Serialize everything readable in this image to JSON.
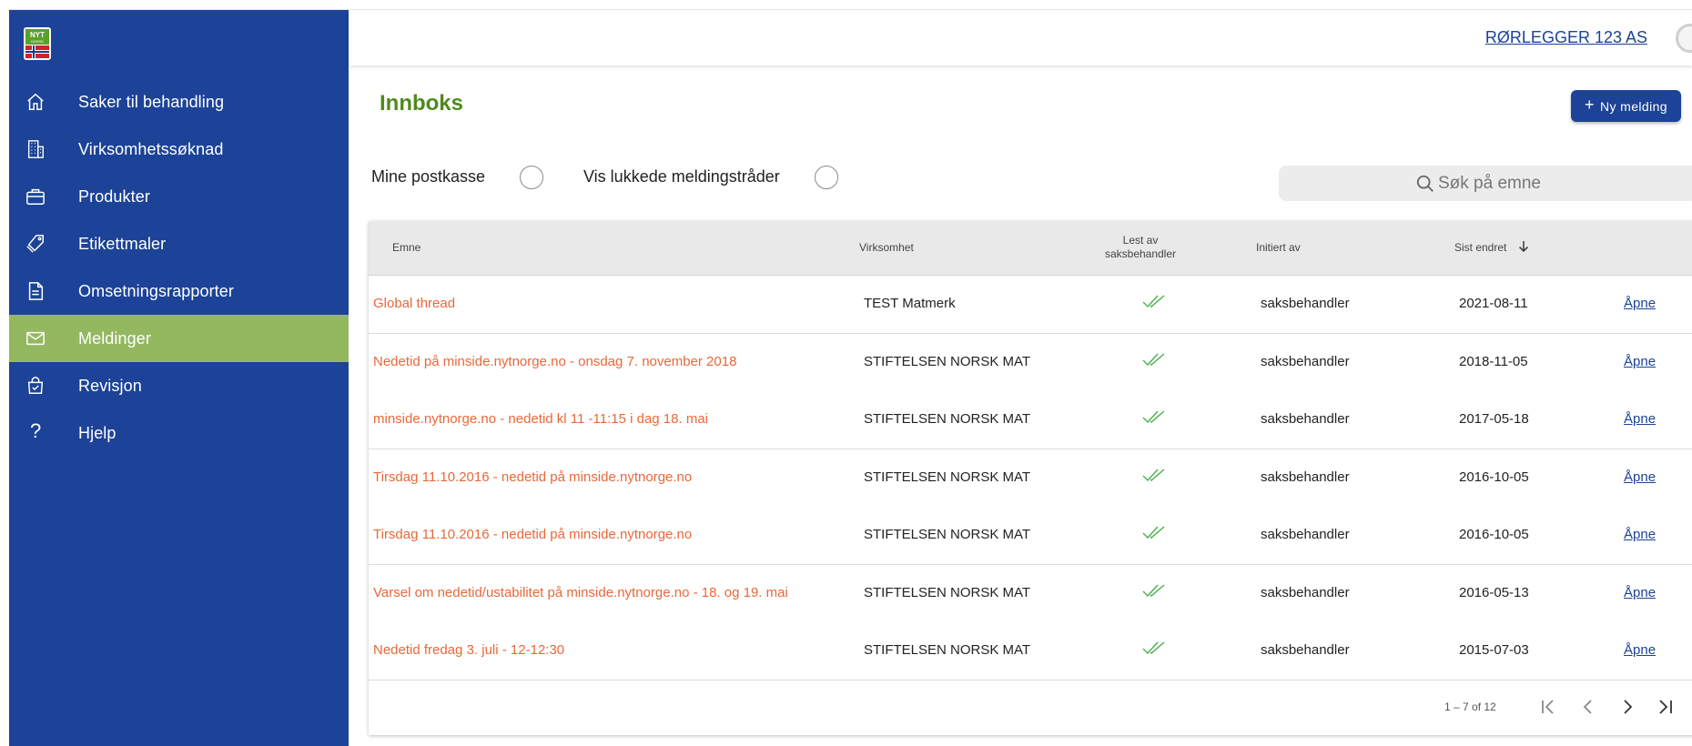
{
  "brand": {
    "logo_text_top": "NYT",
    "logo_text_mid": "NORSK"
  },
  "sidebar": {
    "items": [
      {
        "label": "Saker til behandling",
        "icon": "home-icon"
      },
      {
        "label": "Virksomhetssøknad",
        "icon": "building-icon"
      },
      {
        "label": "Produkter",
        "icon": "briefcase-icon"
      },
      {
        "label": "Etikettmaler",
        "icon": "tags-icon"
      },
      {
        "label": "Omsetningsrapporter",
        "icon": "document-icon"
      },
      {
        "label": "Meldinger",
        "icon": "mail-icon",
        "active": true
      },
      {
        "label": "Revisjon",
        "icon": "shopping-bag-check-icon"
      },
      {
        "label": "Hjelp",
        "icon": "question-icon"
      }
    ]
  },
  "header": {
    "company": "RØRLEGGER 123 AS"
  },
  "page": {
    "title": "Innboks",
    "new_button": "Ny melding"
  },
  "filters": {
    "my_mailbox": "Mine postkasse",
    "show_closed": "Vis lukkede meldingstråder"
  },
  "search": {
    "placeholder": "Søk på emne"
  },
  "table": {
    "headers": {
      "subject": "Emne",
      "company": "Virksomhet",
      "read_line1": "Lest av",
      "read_line2": "saksbehandler",
      "initiated": "Initiert av",
      "last_changed": "Sist endret"
    },
    "rows": [
      {
        "subject": "Global thread",
        "company": "TEST Matmerk",
        "initiated": "saksbehandler",
        "date": "2021-08-11",
        "action": "Åpne"
      },
      {
        "subject": "Nedetid på minside.nytnorge.no - onsdag 7. november 2018",
        "company": "STIFTELSEN NORSK MAT",
        "initiated": "saksbehandler",
        "date": "2018-11-05",
        "action": "Åpne"
      },
      {
        "subject": "minside.nytnorge.no - nedetid kl 11 -11:15 i dag 18. mai",
        "company": "STIFTELSEN NORSK MAT",
        "initiated": "saksbehandler",
        "date": "2017-05-18",
        "action": "Åpne"
      },
      {
        "subject": "Tirsdag 11.10.2016 - nedetid på minside.nytnorge.no",
        "company": "STIFTELSEN NORSK MAT",
        "initiated": "saksbehandler",
        "date": "2016-10-05",
        "action": "Åpne"
      },
      {
        "subject": "Tirsdag 11.10.2016 - nedetid på minside.nytnorge.no",
        "company": "STIFTELSEN NORSK MAT",
        "initiated": "saksbehandler",
        "date": "2016-10-05",
        "action": "Åpne"
      },
      {
        "subject": "Varsel om nedetid/ustabilitet på minside.nytnorge.no - 18. og 19. mai",
        "company": "STIFTELSEN NORSK MAT",
        "initiated": "saksbehandler",
        "date": "2016-05-13",
        "action": "Åpne"
      },
      {
        "subject": "Nedetid fredag 3. juli - 12-12:30",
        "company": "STIFTELSEN NORSK MAT",
        "initiated": "saksbehandler",
        "date": "2015-07-03",
        "action": "Åpne"
      }
    ]
  },
  "pagination": {
    "range": "1 – 7 of 12"
  },
  "colors": {
    "sidebar": "#1c4397",
    "active": "#93b860",
    "title": "#4e8a1e",
    "subject": "#e8683a",
    "check": "#4caf50"
  }
}
